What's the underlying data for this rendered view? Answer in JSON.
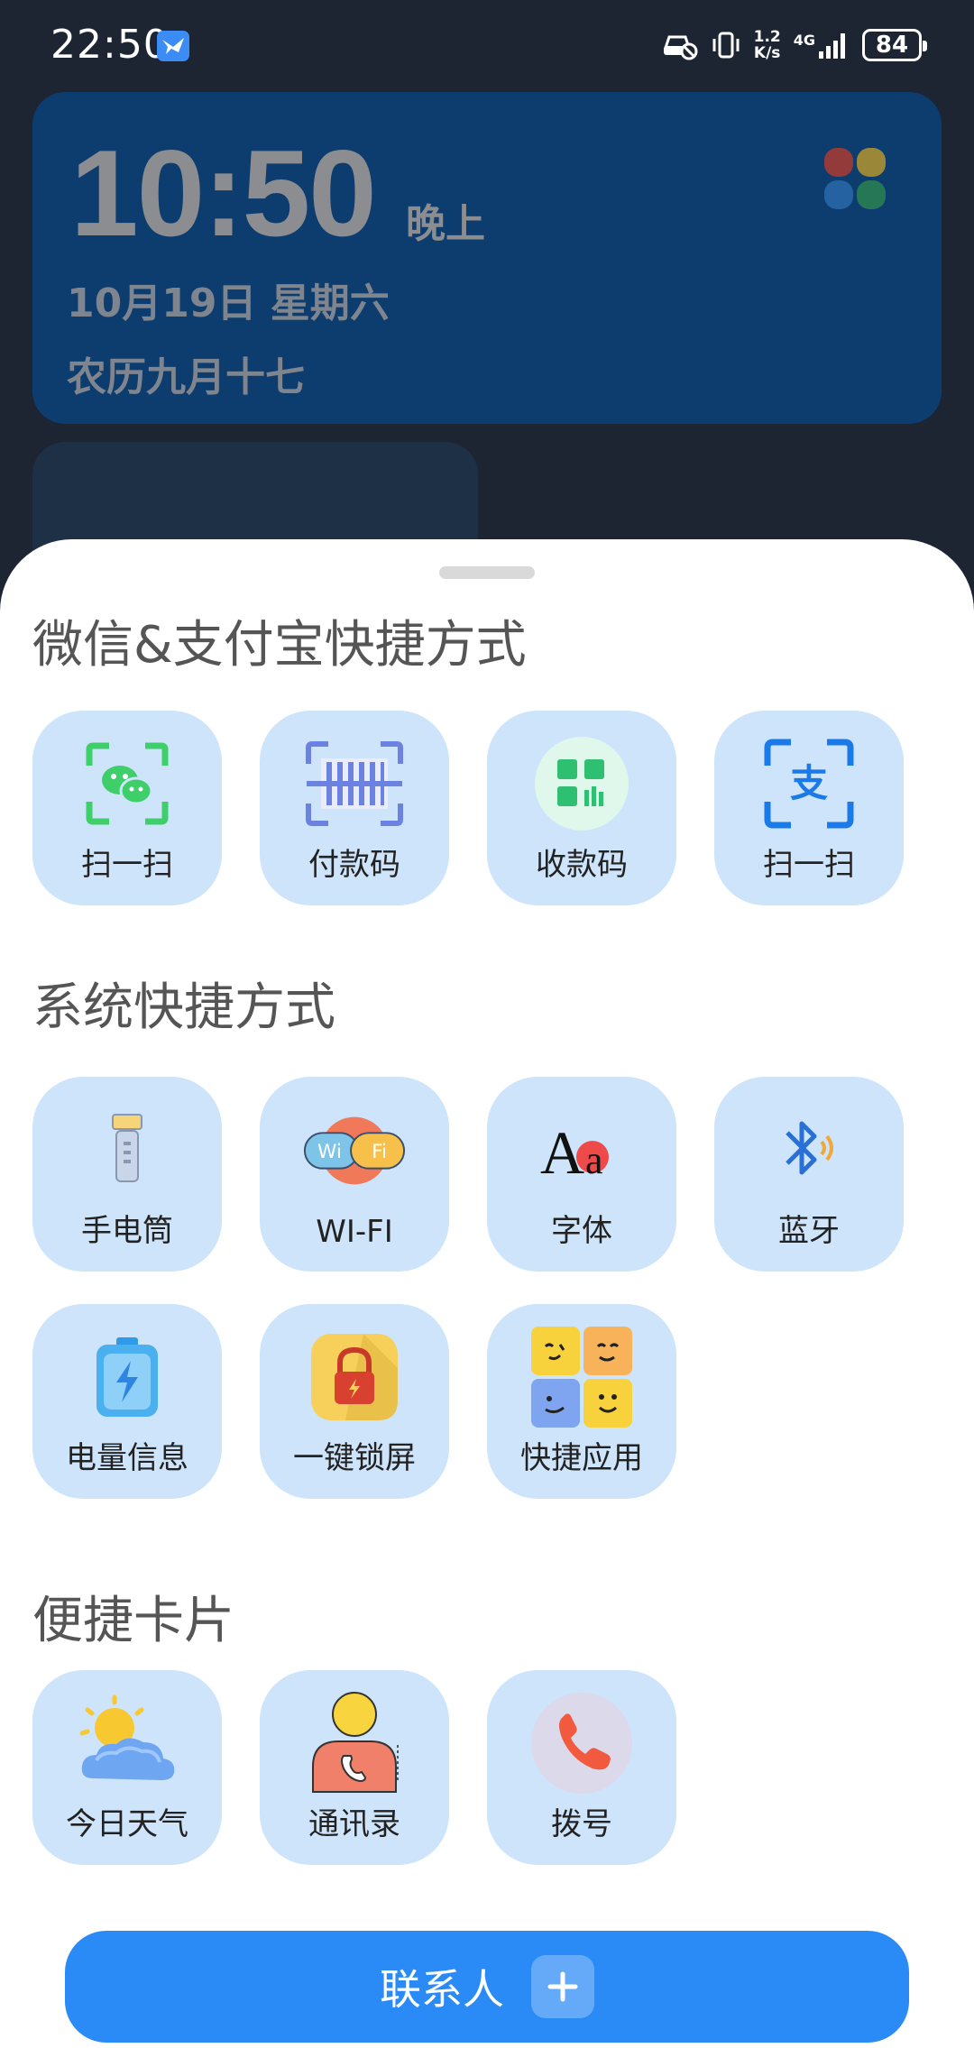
{
  "status_bar": {
    "time": "22:50",
    "net_speed_value": "1.2",
    "net_speed_unit": "K/s",
    "network_type": "4G",
    "battery": "84"
  },
  "clock_widget": {
    "time": "10:50",
    "ampm": "晚上",
    "date": "10月19日  星期六",
    "lunar": "农历九月十七"
  },
  "sections": {
    "payment": {
      "title": "微信&支付宝快捷方式",
      "items": [
        {
          "label": "扫一扫",
          "icon": "wechat-scan-icon"
        },
        {
          "label": "付款码",
          "icon": "payment-barcode-icon"
        },
        {
          "label": "收款码",
          "icon": "receive-qr-icon"
        },
        {
          "label": "扫一扫",
          "icon": "alipay-scan-icon"
        }
      ]
    },
    "system": {
      "title": "系统快捷方式",
      "items": [
        {
          "label": "手电筒",
          "icon": "flashlight-icon"
        },
        {
          "label": "WI-FI",
          "icon": "wifi-icon"
        },
        {
          "label": "字体",
          "icon": "font-icon"
        },
        {
          "label": "蓝牙",
          "icon": "bluetooth-icon"
        },
        {
          "label": "电量信息",
          "icon": "battery-info-icon"
        },
        {
          "label": "一键锁屏",
          "icon": "lock-screen-icon"
        },
        {
          "label": "快捷应用",
          "icon": "quick-apps-icon"
        }
      ]
    },
    "cards": {
      "title": "便捷卡片",
      "items": [
        {
          "label": "今日天气",
          "icon": "weather-icon"
        },
        {
          "label": "通讯录",
          "icon": "contacts-book-icon"
        },
        {
          "label": "拨号",
          "icon": "dialer-icon"
        }
      ]
    }
  },
  "contacts_button": {
    "label": "联系人"
  },
  "colors": {
    "background": "#1d2432",
    "tile": "#cde4fb",
    "primary_button": "#2a8af6",
    "clock_widget": "#0d3c6e"
  }
}
